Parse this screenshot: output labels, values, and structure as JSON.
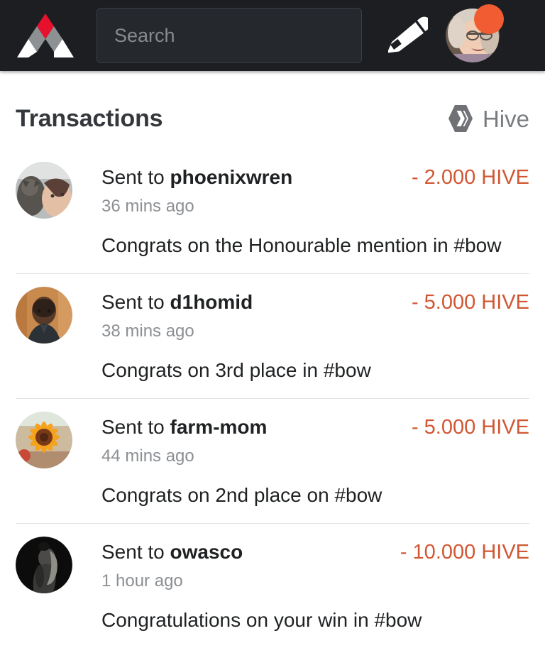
{
  "header": {
    "logo_icon": "actifit-triangle-logo",
    "logo_colors": {
      "top": "#e8112d",
      "mid": "#8e9194",
      "legs": "#ffffff"
    },
    "search": {
      "placeholder": "Search",
      "value": "",
      "button_icon": "search-icon"
    },
    "compose_icon": "pencil-icon",
    "avatar_icon": "user-avatar",
    "notification_badge": {
      "visible": true,
      "color": "#f25c32"
    },
    "background": "#1c1e22"
  },
  "page": {
    "title": "Transactions",
    "brand": {
      "label": "Hive",
      "icon": "hive-logo-icon",
      "color": "#7a7d80"
    }
  },
  "transactions": [
    {
      "action": "Sent to",
      "recipient": "phoenixwren",
      "time": "36 mins ago",
      "amount": "- 2.000 HIVE",
      "memo": "Congrats on the Honourable mention in #bow",
      "avatar_name": "avatar-phoenixwren"
    },
    {
      "action": "Sent to",
      "recipient": "d1homid",
      "time": "38 mins ago",
      "amount": "- 5.000 HIVE",
      "memo": "Congrats on 3rd place in #bow",
      "avatar_name": "avatar-d1homid"
    },
    {
      "action": "Sent to",
      "recipient": "farm-mom",
      "time": "44 mins ago",
      "amount": "- 5.000 HIVE",
      "memo": "Congrats on 2nd place on #bow",
      "avatar_name": "avatar-farm-mom"
    },
    {
      "action": "Sent to",
      "recipient": "owasco",
      "time": "1 hour ago",
      "amount": "- 10.000 HIVE",
      "memo": "Congratulations on your win in #bow",
      "avatar_name": "avatar-owasco"
    }
  ],
  "colors": {
    "amount_negative": "#d15733",
    "title": "#34383c",
    "muted_text": "#8b8f93",
    "body_text": "#1f2123",
    "divider": "#e3e3e3"
  }
}
